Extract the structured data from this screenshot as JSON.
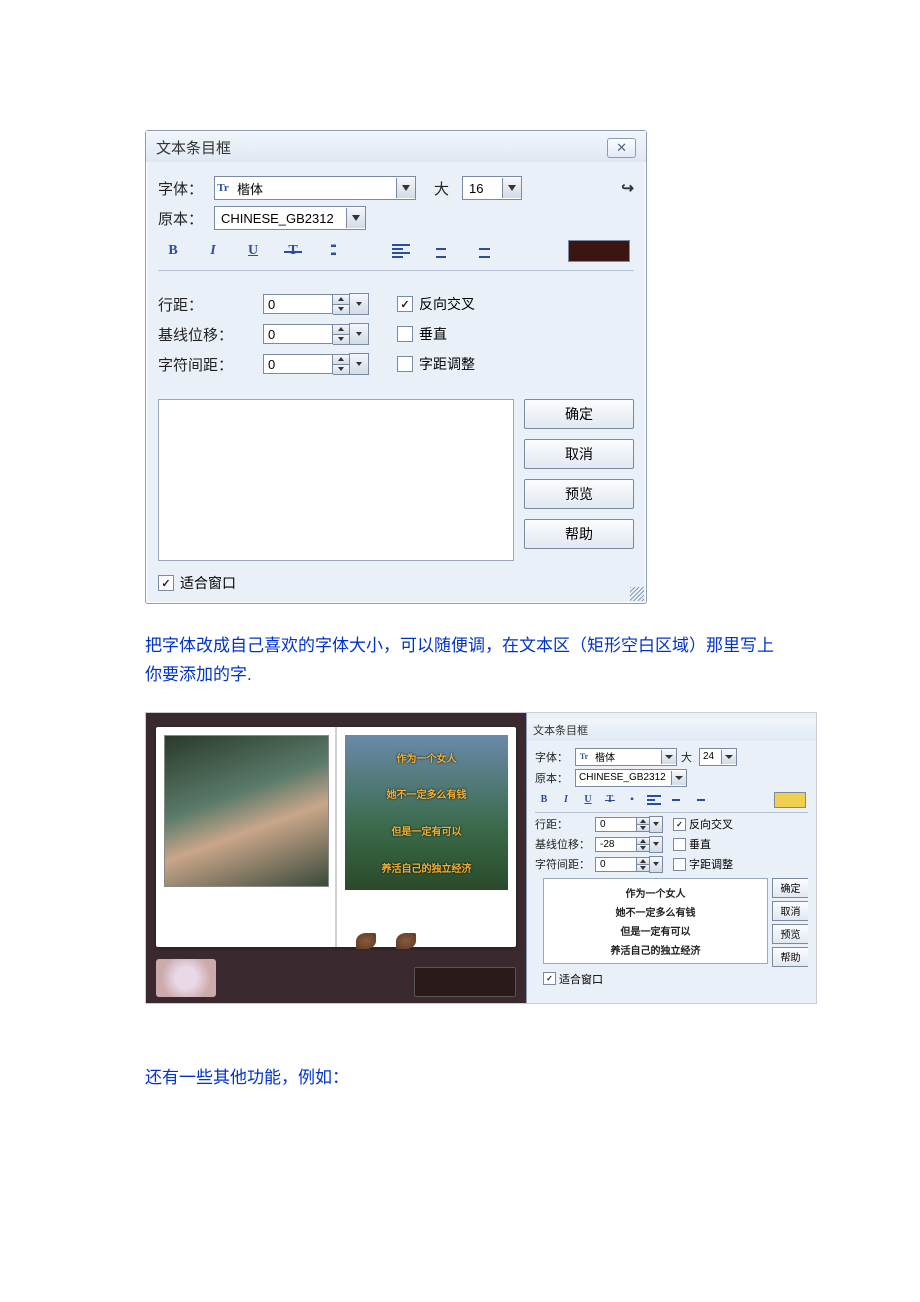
{
  "dialog1": {
    "title": "文本条目框",
    "close": "✕",
    "font_label": "字体：",
    "font_value": "楷体",
    "size_label": "大",
    "size_value": "16",
    "arrow_out": "↪",
    "script_label": "原本：",
    "script_value": "CHINESE_GB2312",
    "spacing": {
      "line_label": "行距：",
      "line_value": "0",
      "baseline_label": "基线位移：",
      "baseline_value": "0",
      "char_label": "字符间距：",
      "char_value": "0"
    },
    "checks": {
      "reverse": "反向交叉",
      "vertical": "垂直",
      "kerning": "字距调整"
    },
    "buttons": {
      "ok": "确定",
      "cancel": "取消",
      "preview": "预览",
      "help": "帮助"
    },
    "fit_window": "适合窗口"
  },
  "paragraph1": "把字体改成自己喜欢的字体大小，可以随便调，在文本区（矩形空白区域）那里写上你要添加的字.",
  "scenery_lines": [
    "作为一个女人",
    "她不一定多么有钱",
    "但是一定有可以",
    "养活自己的独立经济"
  ],
  "dialog2": {
    "title": "文本条目框",
    "font_label": "字体：",
    "font_value": "楷体",
    "size_label": "大",
    "size_value": "24",
    "script_label": "原本：",
    "script_value": "CHINESE_GB2312",
    "spacing": {
      "line_label": "行距：",
      "line_value": "0",
      "baseline_label": "基线位移：",
      "baseline_value": "-28",
      "char_label": "字符间距：",
      "char_value": "0"
    },
    "checks": {
      "reverse": "反向交叉",
      "vertical": "垂直",
      "kerning": "字距调整"
    },
    "preview_lines": [
      "作为一个女人",
      "她不一定多么有钱",
      "但是一定有可以",
      "养活自己的独立经济"
    ],
    "buttons": {
      "ok": "确定",
      "cancel": "取消",
      "preview": "预览",
      "help": "帮助"
    },
    "fit_window": "适合窗口"
  },
  "paragraph2": "还有一些其他功能，例如："
}
